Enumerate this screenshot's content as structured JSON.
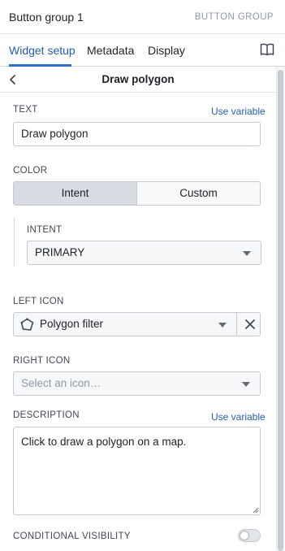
{
  "header": {
    "title": "Button group 1",
    "type": "BUTTON GROUP"
  },
  "tabs": [
    {
      "label": "Widget setup",
      "active": true
    },
    {
      "label": "Metadata",
      "active": false
    },
    {
      "label": "Display",
      "active": false
    }
  ],
  "subheader": {
    "title": "Draw polygon"
  },
  "text_field": {
    "label": "TEXT",
    "link": "Use variable",
    "value": "Draw polygon"
  },
  "color": {
    "label": "COLOR",
    "options": [
      "Intent",
      "Custom"
    ],
    "selected": "Intent"
  },
  "intent": {
    "label": "INTENT",
    "value": "PRIMARY"
  },
  "left_icon": {
    "label": "LEFT ICON",
    "value": "Polygon filter",
    "icon": "polygon-filter-icon"
  },
  "right_icon": {
    "label": "RIGHT ICON",
    "placeholder": "Select an icon…"
  },
  "description": {
    "label": "DESCRIPTION",
    "link": "Use variable",
    "value": "Click to draw a polygon on a map."
  },
  "conditional_visibility": {
    "label": "CONDITIONAL VISIBILITY",
    "enabled": false
  },
  "colors": {
    "accent": "#2d72d2",
    "link": "#215db0",
    "muted": "#8f99a8"
  }
}
